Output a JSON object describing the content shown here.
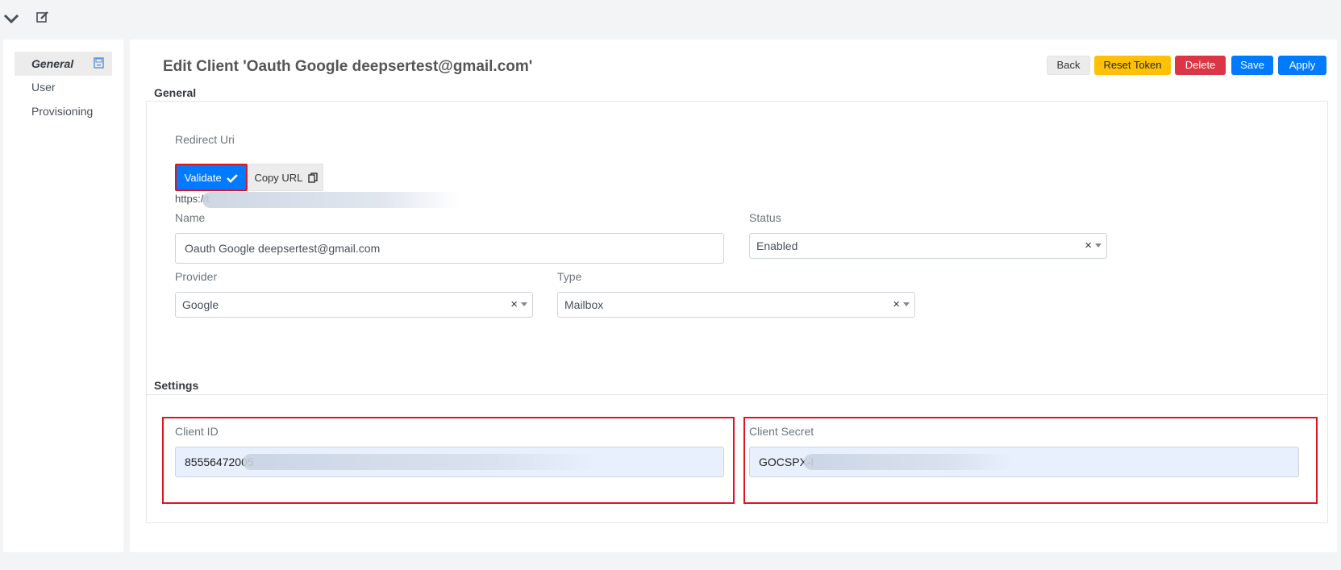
{
  "toolbar": {
    "collapse_icon": "chevron-down-icon",
    "edit_icon": "edit-icon"
  },
  "sidebar": {
    "items": [
      {
        "label": "General",
        "active": true
      },
      {
        "label": "User",
        "active": false
      },
      {
        "label": "Provisioning",
        "active": false
      }
    ]
  },
  "header": {
    "title": "Edit Client 'Oauth Google deepsertest@gmail.com'",
    "buttons": {
      "back": "Back",
      "reset_token": "Reset Token",
      "delete": "Delete",
      "save": "Save",
      "apply": "Apply"
    }
  },
  "general": {
    "section_label": "General",
    "redirect_uri_label": "Redirect Uri",
    "validate_label": "Validate",
    "copy_url_label": "Copy URL",
    "redirect_url_value": "https://t",
    "name_label": "Name",
    "name_value": "Oauth Google deepsertest@gmail.com",
    "status_label": "Status",
    "status_value": "Enabled",
    "provider_label": "Provider",
    "provider_value": "Google",
    "type_label": "Type",
    "type_value": "Mailbox"
  },
  "settings": {
    "section_label": "Settings",
    "client_id_label": "Client ID",
    "client_id_value": "85556472005",
    "client_secret_label": "Client Secret",
    "client_secret_value": "GOCSPX-l"
  },
  "glyphs": {
    "clear": "×"
  },
  "colors": {
    "primary": "#007bff",
    "warning": "#ffc107",
    "danger": "#dc3545",
    "highlight": "#e0141f"
  }
}
